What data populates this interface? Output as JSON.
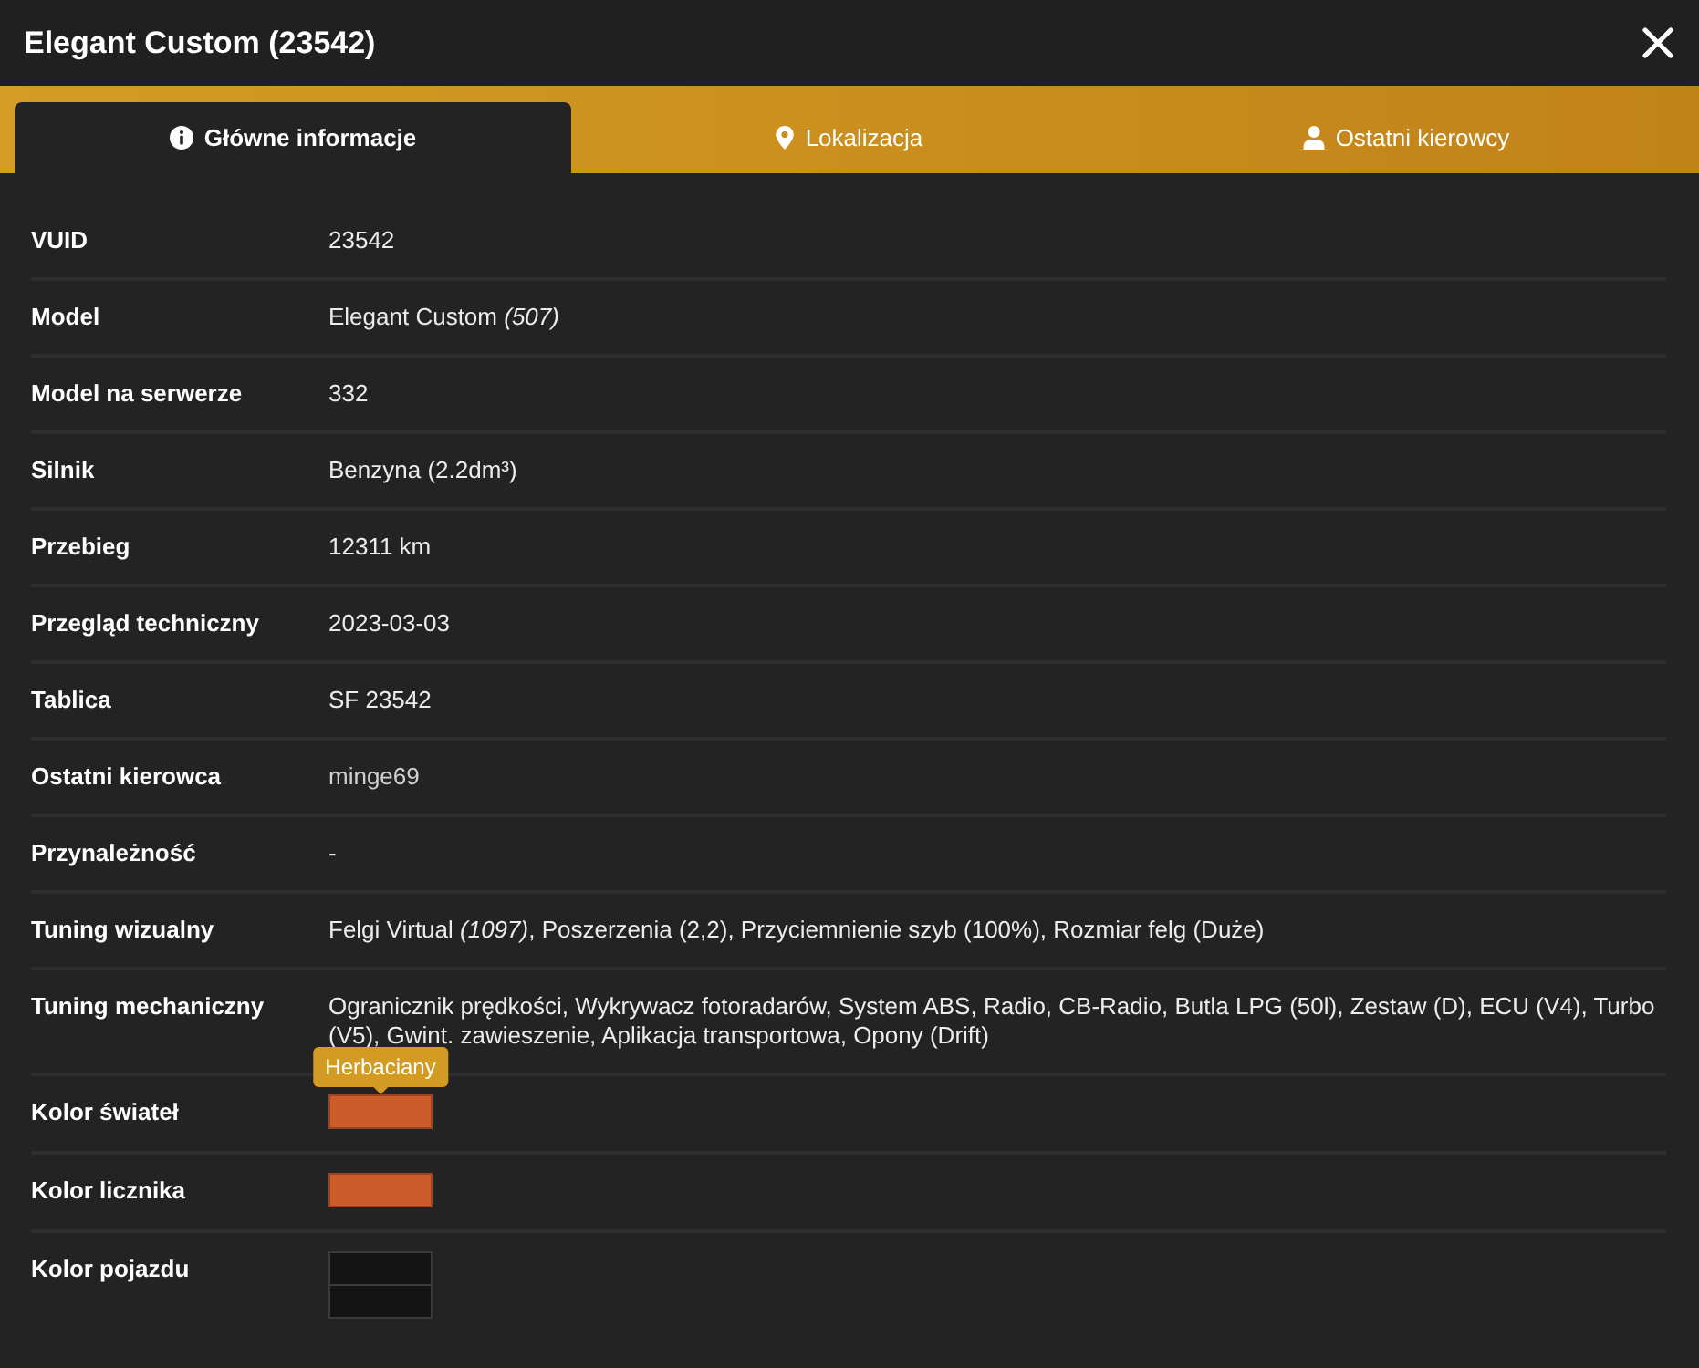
{
  "window": {
    "title": "Elegant Custom (23542)"
  },
  "tabs": [
    {
      "label": "Główne informacje",
      "selected": true
    },
    {
      "label": "Lokalizacja",
      "selected": false
    },
    {
      "label": "Ostatni kierowcy",
      "selected": false
    }
  ],
  "rows": [
    {
      "kind": "text",
      "label": "VUID",
      "value": "23542"
    },
    {
      "kind": "text",
      "label": "Model",
      "value": "Elegant Custom *(507)*"
    },
    {
      "kind": "text",
      "label": "Model na serwerze",
      "value": "332"
    },
    {
      "kind": "text",
      "label": "Silnik",
      "value": "Benzyna (2.2dm³)"
    },
    {
      "kind": "text",
      "label": "Przebieg",
      "value": "12311 km"
    },
    {
      "kind": "text",
      "label": "Przegląd techniczny",
      "value": "2023-03-03"
    },
    {
      "kind": "text",
      "label": "Tablica",
      "value": "SF 23542"
    },
    {
      "kind": "link",
      "label": "Ostatni kierowca",
      "value": "minge69"
    },
    {
      "kind": "text",
      "label": "Przynależność",
      "value": "-"
    },
    {
      "kind": "text",
      "label": "Tuning wizualny",
      "value": "Felgi Virtual *(1097)*, Poszerzenia (2,2), Przyciemnienie szyb (100%), Rozmiar felg (Duże)"
    },
    {
      "kind": "text",
      "label": "Tuning mechaniczny",
      "value": "Ogranicznik prędkości, Wykrywacz fotoradarów, System ABS, Radio, CB-Radio, Butla LPG (50l), Zestaw (D), ECU (V4), Turbo (V5), Gwint. zawieszenie, Aplikacja transportowa, Opony (Drift)"
    },
    {
      "kind": "swatches",
      "label": "Kolor świateł",
      "swatches": [
        {
          "color": "#cd5c2b",
          "tooltip": "Herbaciany"
        }
      ]
    },
    {
      "kind": "swatches",
      "label": "Kolor licznika",
      "swatches": [
        {
          "color": "#cd5c2b"
        }
      ]
    },
    {
      "kind": "swatches",
      "label": "Kolor pojazdu",
      "swatches": [
        {
          "color": "#141414"
        },
        {
          "color": "#141414"
        }
      ]
    }
  ]
}
